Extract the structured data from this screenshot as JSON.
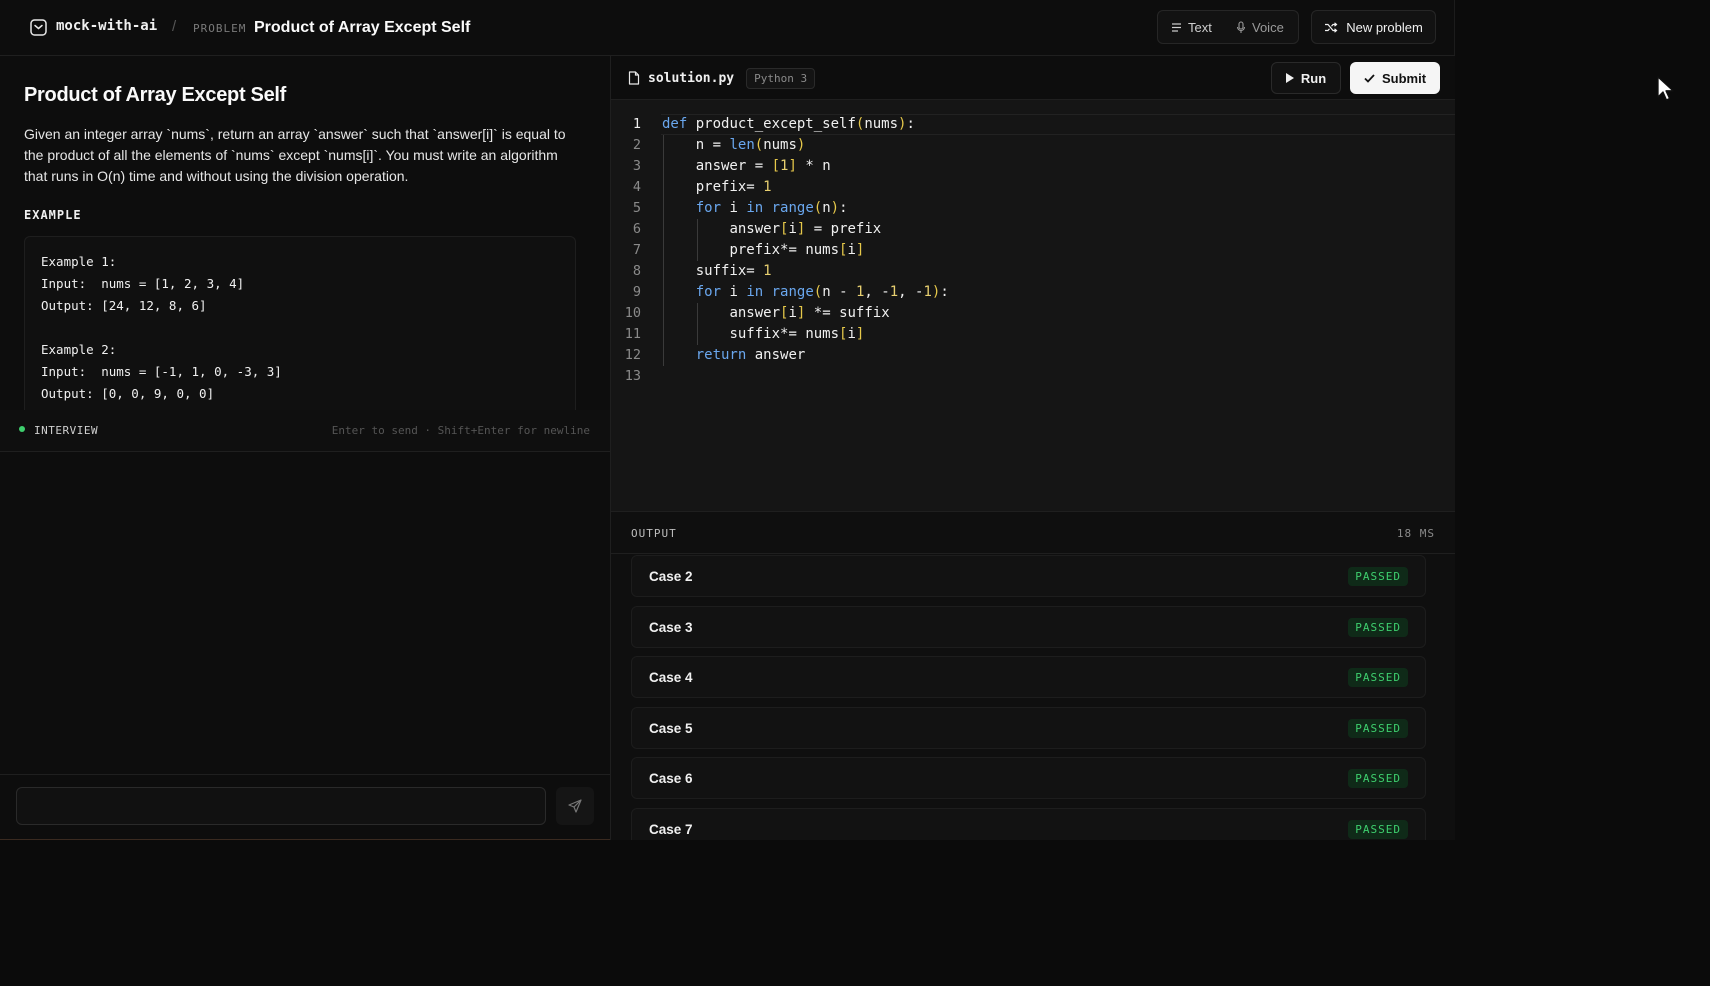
{
  "header": {
    "brand": "mock-with-ai",
    "breadcrumb_separator": "/",
    "breadcrumb_label": "PROBLEM",
    "problem_title": "Product of Array Except Self",
    "modes": {
      "text": "Text",
      "voice": "Voice"
    },
    "new_problem": "New problem"
  },
  "problem": {
    "title": "Product of Array Except Self",
    "description": "Given an integer array `nums`, return an array `answer` such that `answer[i]` is equal to the product of all the elements of `nums` except `nums[i]`. You must write an algorithm that runs in O(n) time and without using the division operation.",
    "example_label": "EXAMPLE",
    "example_text": "Example 1:\nInput:  nums = [1, 2, 3, 4]\nOutput: [24, 12, 8, 6]\n\nExample 2:\nInput:  nums = [-1, 1, 0, -3, 3]\nOutput: [0, 0, 9, 0, 0]"
  },
  "interview": {
    "label": "INTERVIEW",
    "hint": "Enter to send · Shift+Enter for newline",
    "input_value": "",
    "input_placeholder": ""
  },
  "editor": {
    "file_name": "solution.py",
    "language": "Python 3",
    "run_label": "Run",
    "submit_label": "Submit",
    "active_line": 1,
    "line_numbers": [
      "1",
      "2",
      "3",
      "4",
      "5",
      "6",
      "7",
      "8",
      "9",
      "10",
      "11",
      "12",
      "13"
    ],
    "code": [
      "def product_except_self(nums):",
      "    n = len(nums)",
      "    answer = [1] * n",
      "    prefix= 1",
      "    for i in range(n):",
      "        answer[i] = prefix",
      "        prefix*= nums[i]",
      "    suffix= 1",
      "    for i in range(n - 1, -1, -1):",
      "        answer[i] *= suffix",
      "        suffix*= nums[i]",
      "    return answer",
      ""
    ]
  },
  "output": {
    "label": "OUTPUT",
    "time": "18 MS",
    "cases": [
      {
        "name": "Case 2",
        "status": "PASSED"
      },
      {
        "name": "Case 3",
        "status": "PASSED"
      },
      {
        "name": "Case 4",
        "status": "PASSED"
      },
      {
        "name": "Case 5",
        "status": "PASSED"
      },
      {
        "name": "Case 6",
        "status": "PASSED"
      },
      {
        "name": "Case 7",
        "status": "PASSED"
      }
    ]
  },
  "colors": {
    "background": "#0d0d0d",
    "editor_background": "#151515",
    "keyword": "#6aa7ee",
    "number": "#e8d070",
    "bracket": "#e6c84a",
    "passed": "#3ecf6e",
    "passed_bg": "#0f2a18",
    "submit_bg": "#f5f5f5"
  },
  "icons": {
    "logo": "terminal-chevron-icon",
    "text_mode": "lines-icon",
    "voice_mode": "microphone-icon",
    "new_problem": "shuffle-icon",
    "file": "file-icon",
    "run": "play-icon",
    "submit": "check-icon",
    "send": "paper-plane-icon",
    "cursor": "mouse-pointer-icon"
  }
}
